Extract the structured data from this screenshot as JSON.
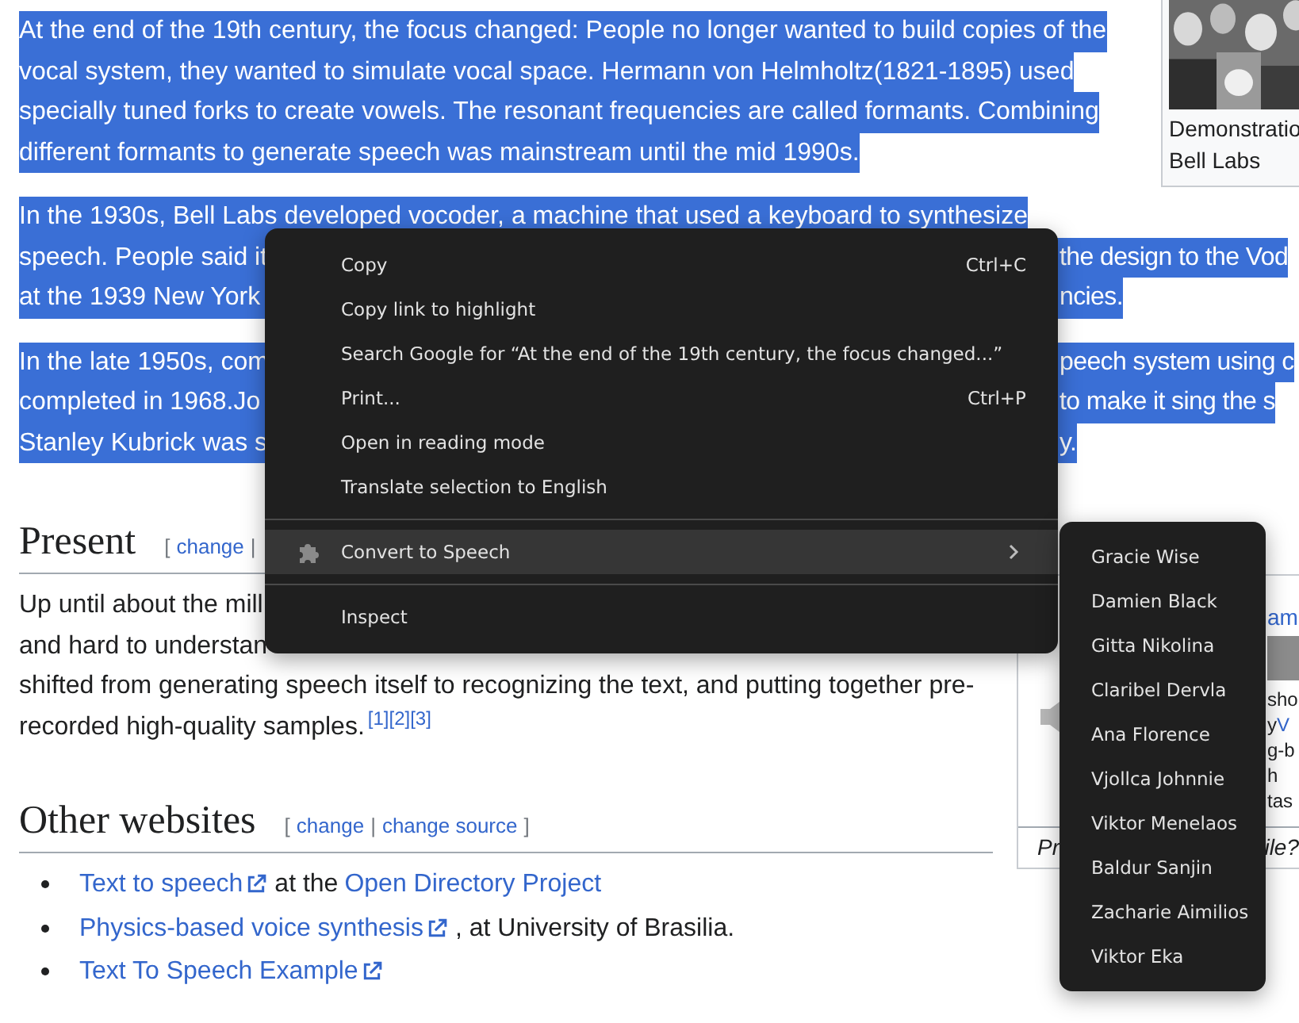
{
  "infobox_top": {
    "kind": "picture",
    "caption": [
      "Demonstratio",
      "Bell Labs"
    ]
  },
  "history_paragraphs": [
    {
      "lines": [
        {
          "kind": "full",
          "selected": true,
          "text": "At the end of the 19th century, the focus changed: People no longer wanted to build copies of the"
        },
        {
          "kind": "full",
          "selected": true,
          "text": "vocal system, they wanted to simulate vocal space. Hermann von Helmholtz(1821-1895) used"
        },
        {
          "kind": "full",
          "selected": true,
          "text": "specially tuned forks to create vowels. The resonant frequencies are called formants. Combining"
        },
        {
          "kind": "full",
          "selected": true,
          "text": "different formants to generate speech was mainstream until the mid 1990s."
        }
      ]
    },
    {
      "lines": [
        {
          "kind": "full",
          "selected": true,
          "text": "In the 1930s, Bell Labs developed vocoder, a machine that used a keyboard to synthesize"
        },
        {
          "kind": "split",
          "selected": true,
          "left": "speech. People said it",
          "right": "the design to the Vod"
        },
        {
          "kind": "split",
          "selected": true,
          "left": "at the 1939 New York",
          "right": "ncies."
        }
      ]
    },
    {
      "lines": [
        {
          "kind": "split",
          "selected": true,
          "left": "In the late 1950s, com",
          "right": "peech system using c"
        },
        {
          "kind": "split",
          "selected": true,
          "left": "completed in 1968.Jo",
          "right": "to make it sing the s"
        },
        {
          "kind": "split",
          "selected": true,
          "left": "Stanley Kubrick was s",
          "right": "y."
        }
      ]
    }
  ],
  "present": {
    "title": "Present",
    "edit": [
      {
        "kind": "punct",
        "text": "["
      },
      {
        "kind": "link",
        "text": "change"
      },
      {
        "kind": "punct",
        "text": "|"
      }
    ],
    "lines": [
      {
        "kind": "full",
        "selected": false,
        "text": "Up until about the mill"
      },
      {
        "kind": "full",
        "selected": false,
        "text": "and hard to understan"
      },
      {
        "kind": "full",
        "selected": false,
        "text": "shifted from generating speech itself to recognizing the text, and putting together pre-"
      },
      {
        "kind": "cite",
        "selected": false,
        "text": "recorded high-quality samples.",
        "refs": [
          "[1]",
          "[2]",
          "[3]"
        ]
      }
    ]
  },
  "other_websites": {
    "title": "Other websites",
    "edit": [
      {
        "kind": "punct",
        "text": "["
      },
      {
        "kind": "link",
        "text": "change"
      },
      {
        "kind": "punct",
        "text": "|"
      },
      {
        "kind": "link",
        "text": "change source"
      },
      {
        "kind": "punct",
        "text": "]"
      }
    ],
    "items": [
      [
        {
          "kind": "link",
          "text": "Text to speech",
          "external": true
        },
        {
          "kind": "text",
          "text": "at the"
        },
        {
          "kind": "link",
          "text": "Open Directory Project",
          "external": false
        }
      ],
      [
        {
          "kind": "link",
          "text": "Physics-based voice synthesis",
          "external": true
        },
        {
          "kind": "text",
          "text": ", at University of Brasilia."
        }
      ],
      [
        {
          "kind": "link",
          "text": "Text To Speech Example",
          "external": true
        }
      ]
    ]
  },
  "infobox_bottom": {
    "link": "am",
    "fragments": [
      {
        "text": "sho"
      },
      {
        "text": "y",
        "link": "V"
      },
      {
        "text": "g-b"
      },
      {
        "text": "h"
      },
      {
        "text": "tas"
      }
    ],
    "caption_left": "Pr",
    "caption_right": "ile?"
  },
  "context_menu": [
    {
      "kind": "item",
      "label": "Copy",
      "shortcut": "Ctrl+C",
      "selected": false
    },
    {
      "kind": "item",
      "label": "Copy link to highlight",
      "selected": false
    },
    {
      "kind": "item",
      "label": "Search Google for “At the end of the 19th century, the focus changed...”",
      "selected": false
    },
    {
      "kind": "item",
      "label": "Print...",
      "shortcut": "Ctrl+P",
      "selected": false
    },
    {
      "kind": "item",
      "label": "Open in reading mode",
      "selected": false
    },
    {
      "kind": "item",
      "label": "Translate selection to English",
      "selected": false
    },
    {
      "kind": "separator"
    },
    {
      "kind": "submenu",
      "label": "Convert to Speech",
      "selected": true
    },
    {
      "kind": "separator"
    },
    {
      "kind": "item",
      "label": "Inspect",
      "selected": false
    }
  ],
  "submenu": [
    "Gracie Wise",
    "Damien Black",
    "Gitta Nikolina",
    "Claribel Dervla",
    "Ana Florence",
    "Vjollca Johnnie",
    "Viktor Menelaos",
    "Baldur Sanjin",
    "Zacharie Aimilios",
    "Viktor Eka"
  ]
}
